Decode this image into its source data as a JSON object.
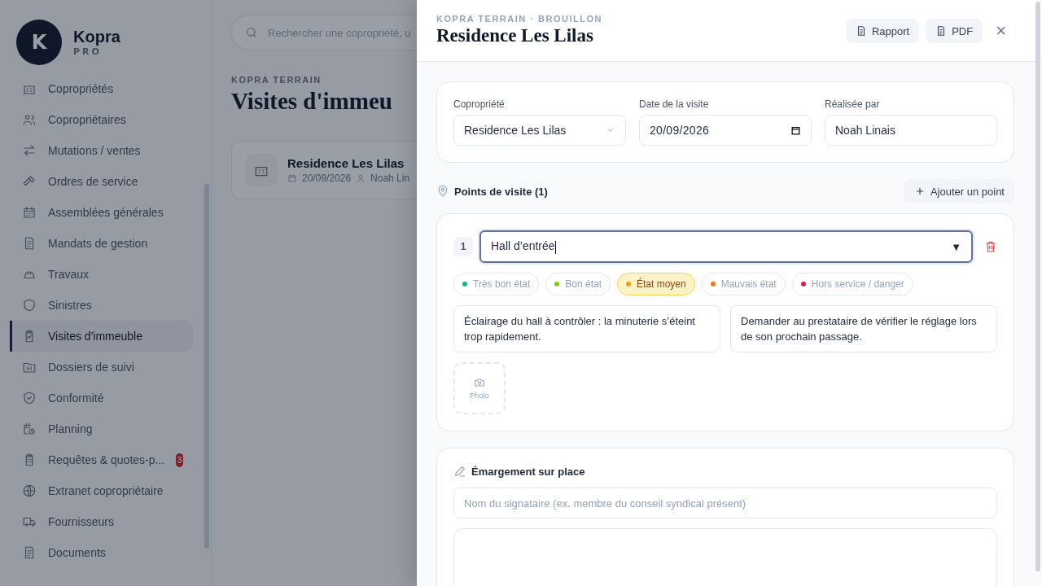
{
  "brand": {
    "logo_letter": "K",
    "name": "Kopra",
    "tier": "PRO"
  },
  "sidebar": {
    "items": [
      {
        "label": "Copropriétés",
        "selected": false
      },
      {
        "label": "Copropriétaires",
        "selected": false
      },
      {
        "label": "Mutations / ventes",
        "selected": false
      },
      {
        "label": "Ordres de service",
        "selected": false
      },
      {
        "label": "Assemblées générales",
        "selected": false
      },
      {
        "label": "Mandats de gestion",
        "selected": false
      },
      {
        "label": "Travaux",
        "selected": false
      },
      {
        "label": "Sinistres",
        "selected": false
      },
      {
        "label": "Visites d'immeuble",
        "selected": true
      },
      {
        "label": "Dossiers de suivi",
        "selected": false
      },
      {
        "label": "Conformité",
        "selected": false
      },
      {
        "label": "Planning",
        "selected": false
      },
      {
        "label": "Requêtes & quotes-p...",
        "selected": false,
        "badge": "3"
      },
      {
        "label": "Extranet copropriétaire",
        "selected": false
      },
      {
        "label": "Fournisseurs",
        "selected": false
      },
      {
        "label": "Documents",
        "selected": false
      }
    ]
  },
  "page": {
    "search": {
      "placeholder": "Rechercher une copropriété, u"
    },
    "eyebrow": "KOPRA TERRAIN",
    "title": "Visites d'immeu",
    "visits": [
      {
        "name": "Residence Les Lilas",
        "date": "20/09/2026",
        "author": "Noah Lin"
      }
    ]
  },
  "drawer": {
    "eyebrow": "KOPRA TERRAIN · BROUILLON",
    "title": "Residence Les Lilas",
    "actions": [
      "Rapport",
      "PDF"
    ],
    "close": "×",
    "fields": [
      {
        "kind": "select",
        "label": "Copropriété",
        "value": "Residence Les Lilas"
      },
      {
        "kind": "date",
        "label": "Date de la visite",
        "value": "20/09/2026"
      },
      {
        "kind": "text",
        "label": "Réalisée par",
        "value": "Noah Linais"
      }
    ],
    "points_title": "Points de visite (1)",
    "add_point": "Ajouter un point",
    "points": [
      {
        "number": "1",
        "name": "Hall d’entrée",
        "dropdown": "▼",
        "statuses": [
          {
            "label": "Très bon état",
            "color": "#10b981",
            "selected": false
          },
          {
            "label": "Bon état",
            "color": "#84cc16",
            "selected": false
          },
          {
            "label": "État moyen",
            "color": "#f59e0b",
            "selected": true
          },
          {
            "label": "Mauvais état",
            "color": "#f97316",
            "selected": false
          },
          {
            "label": "Hors service / danger",
            "color": "#e11d48",
            "selected": false
          }
        ],
        "observation": "Éclairage du hall à contrôler : la minuterie s’éteint trop rapidement.",
        "action": "Demander au prestataire de vérifier le réglage lors de son prochain passage.",
        "photo_label": "Photo"
      }
    ],
    "signature": {
      "title": "Émargement sur place",
      "placeholder": "Nom du signataire (ex. membre du conseil syndical présent)"
    }
  }
}
